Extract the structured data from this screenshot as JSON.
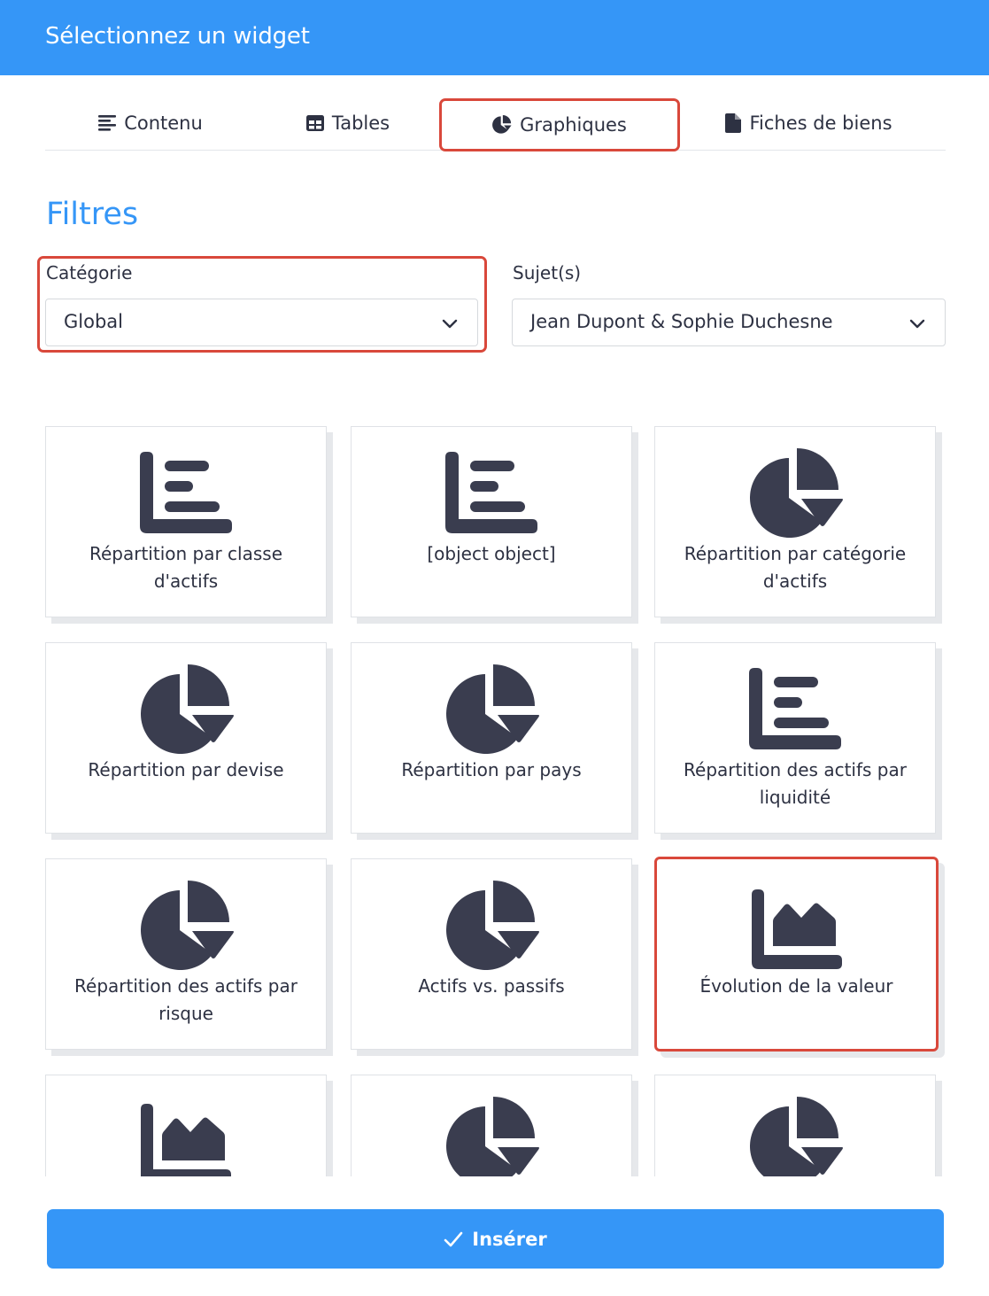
{
  "header": {
    "title": "Sélectionnez un widget"
  },
  "tabs": [
    {
      "label": "Contenu",
      "icon": "align-left-icon"
    },
    {
      "label": "Tables",
      "icon": "table-icon"
    },
    {
      "label": "Graphiques",
      "icon": "pie-chart-icon",
      "active": true
    },
    {
      "label": "Fiches de biens",
      "icon": "file-icon"
    }
  ],
  "filters": {
    "title": "Filtres",
    "category": {
      "label": "Catégorie",
      "value": "Global"
    },
    "subjects": {
      "label": "Sujet(s)",
      "value": "Jean Dupont & Sophie Duchesne"
    }
  },
  "widgets": [
    {
      "label": "Répartition par classe d'actifs",
      "icon": "bar-chart-icon"
    },
    {
      "label": "[object object]",
      "icon": "bar-chart-icon"
    },
    {
      "label": "Répartition par catégorie d'actifs",
      "icon": "pie-chart-icon"
    },
    {
      "label": "Répartition par devise",
      "icon": "pie-chart-icon"
    },
    {
      "label": "Répartition par pays",
      "icon": "pie-chart-icon"
    },
    {
      "label": "Répartition des actifs par liquidité",
      "icon": "bar-chart-icon"
    },
    {
      "label": "Répartition des actifs par risque",
      "icon": "pie-chart-icon"
    },
    {
      "label": "Actifs vs. passifs",
      "icon": "pie-chart-icon"
    },
    {
      "label": "Évolution de la valeur",
      "icon": "area-chart-icon",
      "selected": true
    },
    {
      "label": "",
      "icon": "area-chart-icon"
    },
    {
      "label": "",
      "icon": "pie-chart-icon"
    },
    {
      "label": "",
      "icon": "pie-chart-icon"
    }
  ],
  "footer": {
    "insert_label": "Insérer",
    "icon": "check-icon"
  },
  "colors": {
    "primary": "#3596f7",
    "highlight": "#d9483b",
    "icon": "#3a3d4f"
  }
}
